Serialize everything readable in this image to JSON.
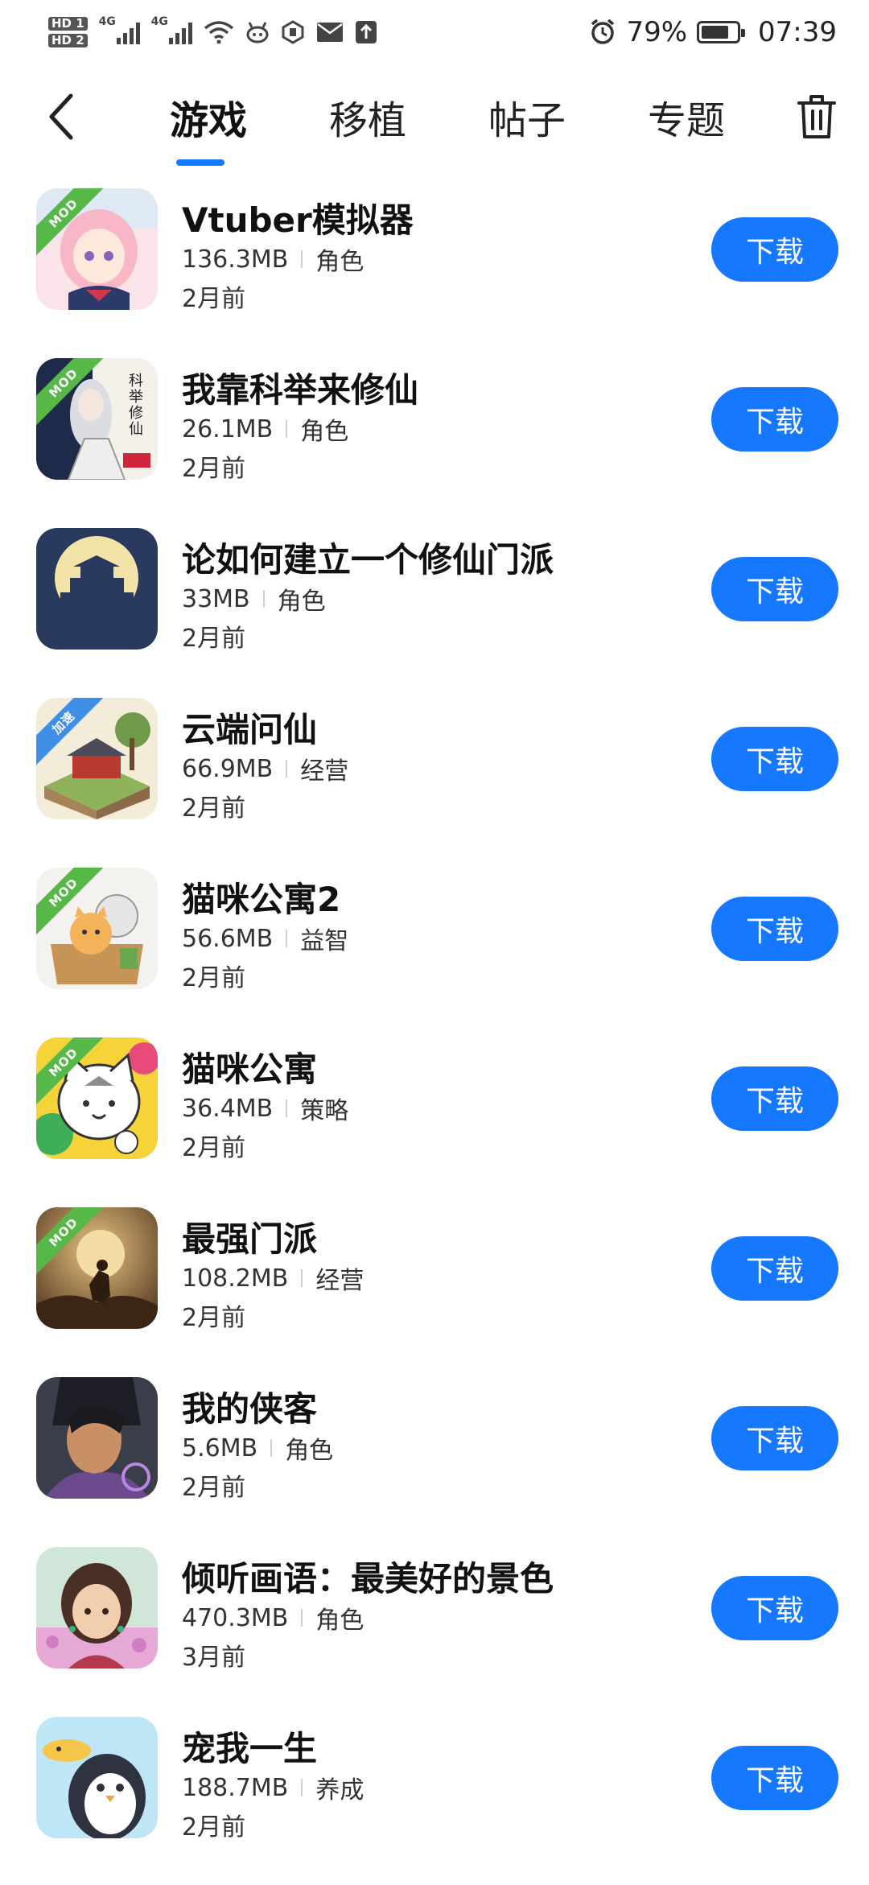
{
  "status_bar": {
    "hd1": "HD 1",
    "hd2": "HD 2",
    "net1": "4G",
    "net2": "4G",
    "battery_pct": "79%",
    "battery_level": 0.79,
    "time": "07:39",
    "icons": [
      "signal-icon",
      "wifi-icon",
      "app-notification-icon",
      "shield-icon",
      "mail-icon",
      "upload-icon",
      "alarm-icon",
      "battery-icon"
    ]
  },
  "header": {
    "tabs": [
      {
        "label": "游戏",
        "active": true
      },
      {
        "label": "移植",
        "active": false
      },
      {
        "label": "帖子",
        "active": false
      },
      {
        "label": "专题",
        "active": false
      }
    ],
    "accent": "#1677ff"
  },
  "apps": [
    {
      "name": "Vtuber模拟器",
      "size": "136.3MB",
      "category": "角色",
      "time": "2月前",
      "badge": "MOD",
      "button": "下载"
    },
    {
      "name": "我靠科举来修仙",
      "size": "26.1MB",
      "category": "角色",
      "time": "2月前",
      "badge": "MOD",
      "button": "下载"
    },
    {
      "name": "论如何建立一个修仙门派",
      "size": "33MB",
      "category": "角色",
      "time": "2月前",
      "badge": "",
      "button": "下载"
    },
    {
      "name": "云端问仙",
      "size": "66.9MB",
      "category": "经营",
      "time": "2月前",
      "badge": "加速",
      "button": "下载"
    },
    {
      "name": "猫咪公寓2",
      "size": "56.6MB",
      "category": "益智",
      "time": "2月前",
      "badge": "MOD",
      "button": "下载"
    },
    {
      "name": "猫咪公寓",
      "size": "36.4MB",
      "category": "策略",
      "time": "2月前",
      "badge": "MOD",
      "button": "下载"
    },
    {
      "name": "最强门派",
      "size": "108.2MB",
      "category": "经营",
      "time": "2月前",
      "badge": "MOD",
      "button": "下载"
    },
    {
      "name": "我的侠客",
      "size": "5.6MB",
      "category": "角色",
      "time": "2月前",
      "badge": "",
      "button": "下载"
    },
    {
      "name": "倾听画语：最美好的景色",
      "size": "470.3MB",
      "category": "角色",
      "time": "3月前",
      "badge": "",
      "button": "下载"
    },
    {
      "name": "宠我一生",
      "size": "188.7MB",
      "category": "养成",
      "time": "2月前",
      "badge": "",
      "button": "下载"
    }
  ]
}
